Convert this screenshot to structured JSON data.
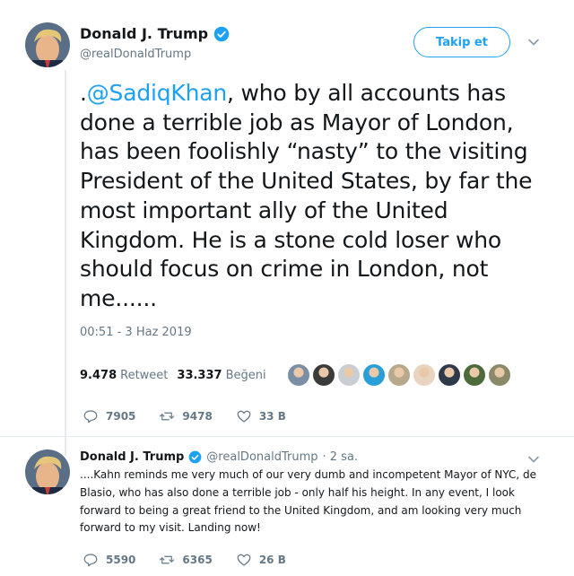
{
  "main_tweet": {
    "display_name": "Donald J. Trump",
    "handle": "@realDonaldTrump",
    "follow_label": "Takip et",
    "text_prefix": ".",
    "mention": "@SadiqKhan",
    "text_body": ", who by all accounts has done a terrible job as Mayor of London, has been foolishly “nasty” to the visiting President of the United States, by far the most important ally of the United Kingdom. He is a stone cold loser who should focus on crime in London, not me......",
    "timestamp": "00:51 - 3 Haz 2019",
    "retweet_count": "9.478",
    "retweet_label": "Retweet",
    "like_count": "33.337",
    "like_label": "Beğeni",
    "liker_avatar_colors": [
      "#7a8fa6",
      "#3b3b3b",
      "#c9ced4",
      "#2a9fd6",
      "#b9a98c",
      "#e8d4c0",
      "#2e3a4a",
      "#4d6b3a",
      "#8a8a6a"
    ],
    "replies": "7905",
    "retweets": "9478",
    "likes": "33 B"
  },
  "reply_tweet": {
    "display_name": "Donald J. Trump",
    "handle": "@realDonaldTrump",
    "time": "· 2 sa.",
    "text": "....Kahn reminds me very much of our very dumb and incompetent Mayor of NYC, de Blasio, who has also done a terrible job - only half his height. In any event, I look forward to being a great friend to the United Kingdom, and am looking very much forward to my visit. Landing now!",
    "replies": "5590",
    "retweets": "6365",
    "likes": "26 B"
  },
  "colors": {
    "accent": "#1da1f2",
    "muted": "#657786",
    "text": "#14171a"
  }
}
